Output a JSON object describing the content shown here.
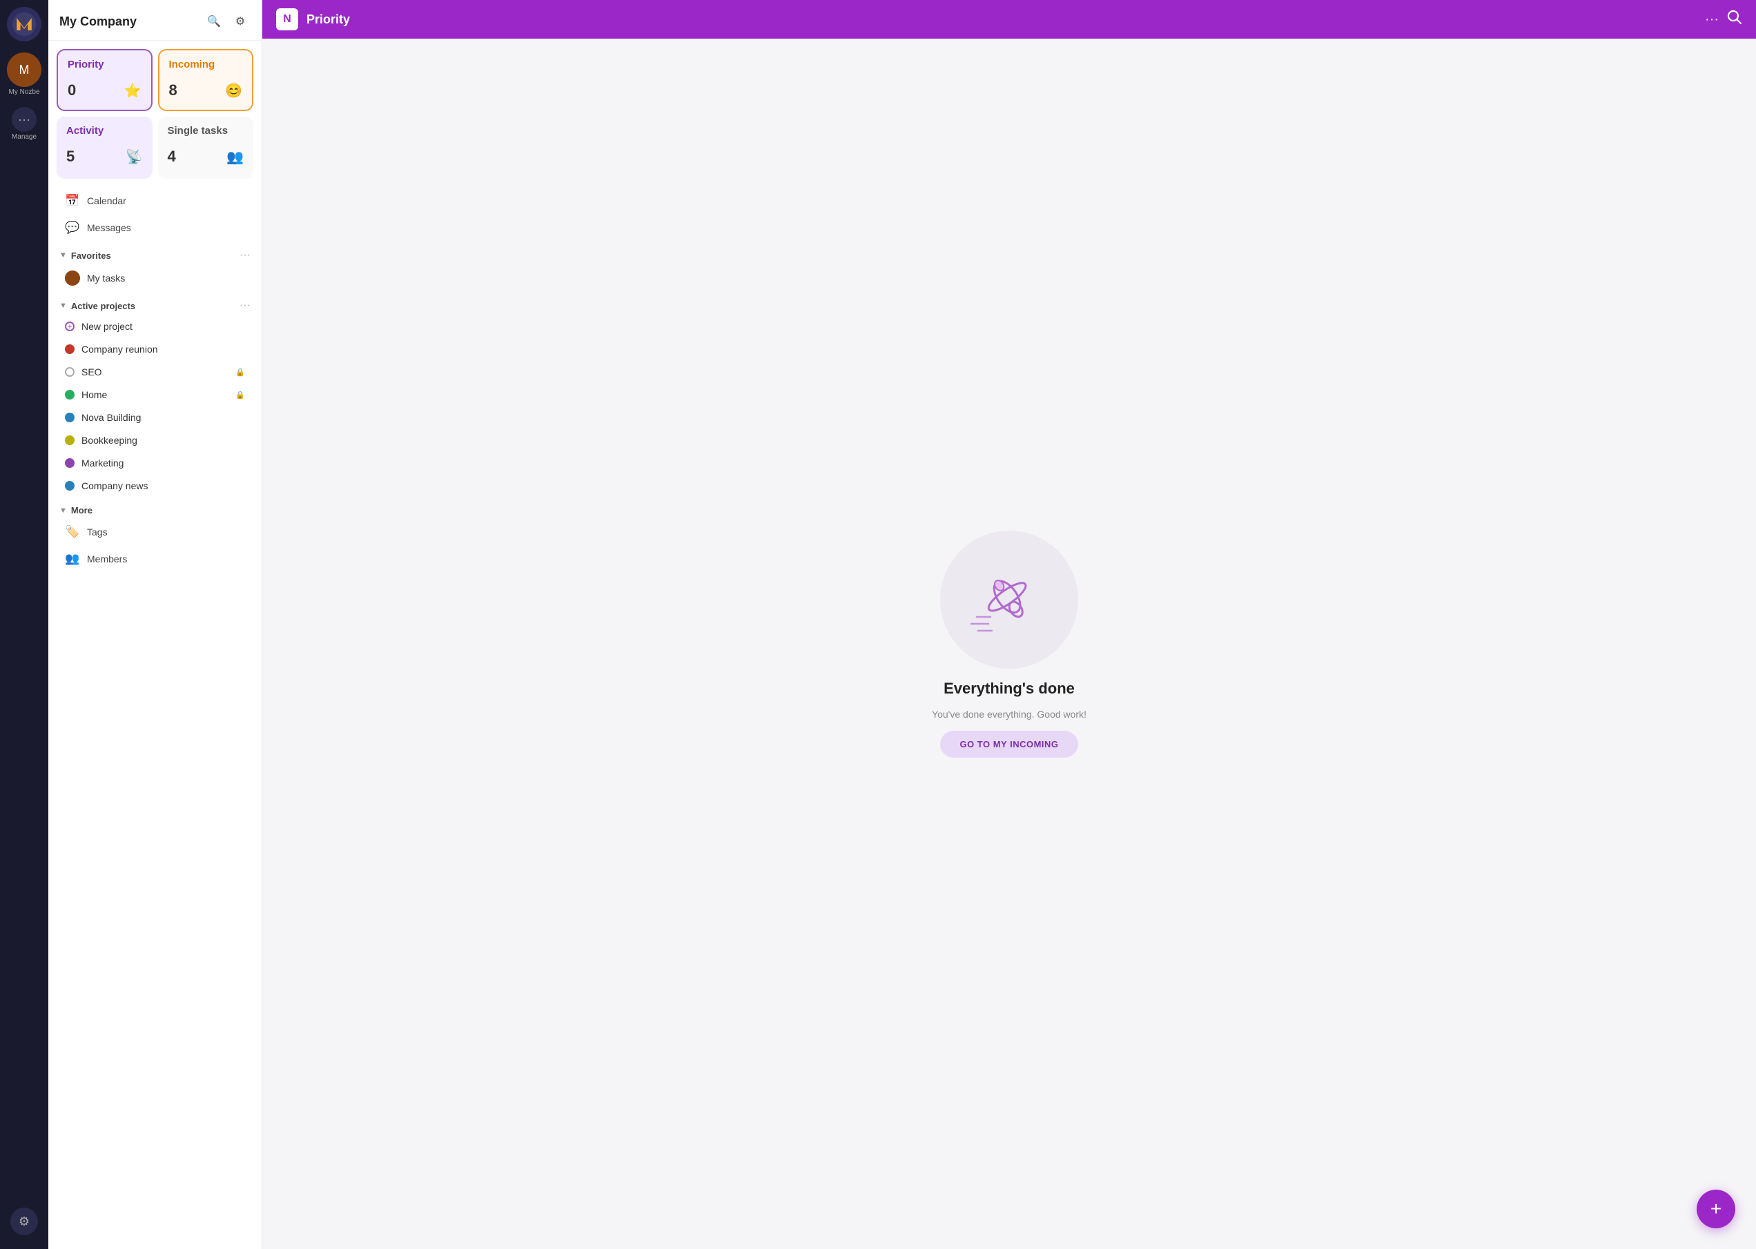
{
  "app": {
    "company_name": "My Company",
    "avatar_letter": "M"
  },
  "iconbar": {
    "my_nozbe_label": "My Nozbe",
    "manage_label": "Manage"
  },
  "topbar": {
    "logo_text": "N",
    "title": "Priority",
    "dots": "···",
    "search_icon": "search"
  },
  "tiles": [
    {
      "id": "priority",
      "label": "Priority",
      "count": "0",
      "icon": "⭐"
    },
    {
      "id": "incoming",
      "label": "Incoming",
      "count": "8",
      "icon": "😊"
    },
    {
      "id": "activity",
      "label": "Activity",
      "count": "5",
      "icon": "📡"
    },
    {
      "id": "single-tasks",
      "label": "Single tasks",
      "count": "4",
      "icon": "👥"
    }
  ],
  "nav": [
    {
      "id": "calendar",
      "label": "Calendar",
      "icon": "📅"
    },
    {
      "id": "messages",
      "label": "Messages",
      "icon": "💬"
    }
  ],
  "favorites": {
    "label": "Favorites",
    "dots": "···",
    "items": [
      {
        "id": "my-tasks",
        "label": "My tasks",
        "avatar": "🟤"
      }
    ]
  },
  "active_projects": {
    "label": "Active projects",
    "dots": "···",
    "items": [
      {
        "id": "new-project",
        "label": "New project",
        "color": "outline-purple",
        "type": "plus"
      },
      {
        "id": "company-reunion",
        "label": "Company reunion",
        "color": "#c0392b"
      },
      {
        "id": "seo",
        "label": "SEO",
        "color": "outline-gray",
        "badge": "🔒"
      },
      {
        "id": "home",
        "label": "Home",
        "color": "#27ae60",
        "badge": "🔒"
      },
      {
        "id": "nova-building",
        "label": "Nova Building",
        "color": "#2980b9"
      },
      {
        "id": "bookkeeping",
        "label": "Bookkeeping",
        "color": "#b8b000"
      },
      {
        "id": "marketing",
        "label": "Marketing",
        "color": "#8e44ad"
      },
      {
        "id": "company-news",
        "label": "Company news",
        "color": "#2980b9"
      }
    ]
  },
  "more_section": {
    "label": "More",
    "items": [
      {
        "id": "tags",
        "label": "Tags",
        "icon": "🏷️"
      },
      {
        "id": "members",
        "label": "Members",
        "icon": "👥"
      }
    ]
  },
  "empty_state": {
    "title": "Everything's done",
    "subtitle": "You've done everything. Good work!",
    "button_label": "GO TO MY INCOMING"
  },
  "fab": {
    "icon": "+"
  }
}
